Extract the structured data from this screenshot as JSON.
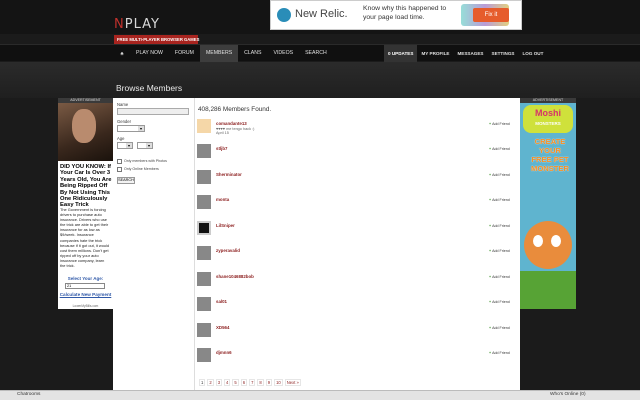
{
  "header": {
    "logo_first": "N",
    "logo_rest": "PLAY",
    "tagline": "FREE MULTI-PLAYER BROWSER GAMES"
  },
  "top_ad": {
    "brand": "New Relic.",
    "message": "Know why this happened to your page load time.",
    "cta": "Fix it"
  },
  "nav": {
    "items": [
      "PLAY NOW",
      "FORUM",
      "MEMBERS",
      "CLANS",
      "VIDEOS",
      "SEARCH"
    ],
    "active_index": 2,
    "right": {
      "updates": "0 UPDATES",
      "profile": "MY PROFILE",
      "messages": "MESSAGES",
      "settings": "SETTINGS",
      "logout": "LOG OUT"
    }
  },
  "section": {
    "title": "Browse Members"
  },
  "left_ad": {
    "label": "ADVERTISEMENT",
    "headline": "DID YOU KNOW: If Your Car Is Over 3 Years Old, You Are Being Ripped Off By Not Using This One Ridiculously Easy Trick",
    "body": "The Government is forcing drivers to purchase auto insurance. Drivers who use the trick are able to get their insurance for as low as $9/week. Insurance companies hate the trick because if it got out, it would cost them millions. Don't get ripped off by your auto insurance company, learn the trick.",
    "age_label": "Select Your Age:",
    "age_value": "21",
    "calc": "Calculate New Payment",
    "site": "LowerMyBills.com"
  },
  "filters": {
    "name_label": "Name",
    "gender_label": "Gender",
    "age_label": "Age",
    "photos_only": "Only members with Photos",
    "online_only": "Only Online Members",
    "search_button": "SEARCH"
  },
  "results": {
    "count": "408,286 Members Found.",
    "add_label": "Add Friend",
    "members": [
      {
        "name": "comandante13",
        "status": "♥♥♥♥ me tengo hack :)",
        "date": "April 15"
      },
      {
        "name": "stljb7",
        "status": "",
        "date": ""
      },
      {
        "name": "Sherminator",
        "status": "",
        "date": ""
      },
      {
        "name": "monta",
        "status": "",
        "date": ""
      },
      {
        "name": "LilSniper",
        "status": "",
        "date": ""
      },
      {
        "name": "zyperavalid",
        "status": "",
        "date": ""
      },
      {
        "name": "shane1046882bob",
        "status": "",
        "date": ""
      },
      {
        "name": "sal01",
        "status": "",
        "date": ""
      },
      {
        "name": "XD564",
        "status": "",
        "date": ""
      },
      {
        "name": "djmnn6",
        "status": "",
        "date": ""
      }
    ],
    "pages": [
      "1",
      "2",
      "3",
      "4",
      "5",
      "6",
      "7",
      "8",
      "9",
      "10",
      "Next »"
    ]
  },
  "right_ad": {
    "label": "ADVERTISEMENT",
    "brand": "Moshi",
    "brand_sub": "MONSTERS",
    "cta": "CREATE YOUR FREE PET MONSTER"
  },
  "taskbar": {
    "chatrooms": "Chatrooms",
    "online": "Who's Online (0)"
  }
}
